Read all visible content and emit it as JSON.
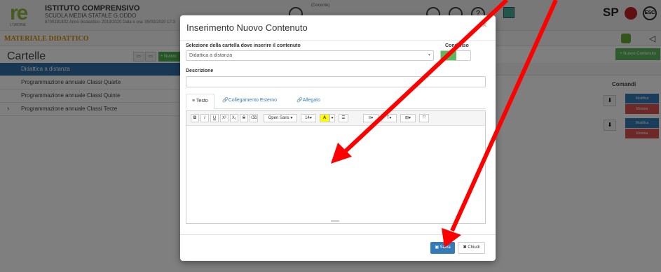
{
  "header": {
    "logo_letters": "re",
    "logo_caption": "L'ORDINE",
    "school_name": "ISTITUTO COMPRENSIVO",
    "school_sub": "SCUOLA MEDIA STATALE G.ODDO",
    "school_info": "8700191802    Anno Scolastico: 2019/2020   Data e ora: 09/03/2020 17:3",
    "user_role": "(Docente)",
    "sp_logo": "SP",
    "esc_label": "ESC"
  },
  "brand": {
    "title": "MATERIALE DIDATTICO"
  },
  "sidebar": {
    "title": "Cartelle",
    "new_label": "+ Nuovo",
    "items": [
      {
        "label": "Didattica a distanza"
      },
      {
        "label": "Programmazione annuale Classi Quarte"
      },
      {
        "label": "Programmazione annuale Classi Quinte"
      },
      {
        "label": "Programmazione annuale Classi Terze"
      }
    ]
  },
  "main": {
    "new_content_label": "+ Nuovo Contenuto",
    "comandi_label": "Comandi",
    "modifica_label": "Modifica",
    "elimina_label": "Elimina"
  },
  "modal": {
    "title": "Inserimento Nuovo Contenuto",
    "folder_label": "Selezione della cartella dove inserire il contenuto",
    "folder_value": "Didattica a distanza",
    "shared_label": "Condiviso",
    "shared_value": "Sì",
    "description_label": "Descrizione",
    "tabs": [
      {
        "label": "Testo"
      },
      {
        "label": "Collegamento Esterno"
      },
      {
        "label": "Allegato"
      }
    ],
    "toolbar": {
      "font": "Open Sans",
      "size": "14"
    },
    "save_label": "Salva",
    "close_label": "Chiudi"
  },
  "colors": {
    "primary": "#337ab7",
    "success": "#5cb85c",
    "danger": "#d9534f",
    "annotation_arrow": "#ff0000"
  }
}
